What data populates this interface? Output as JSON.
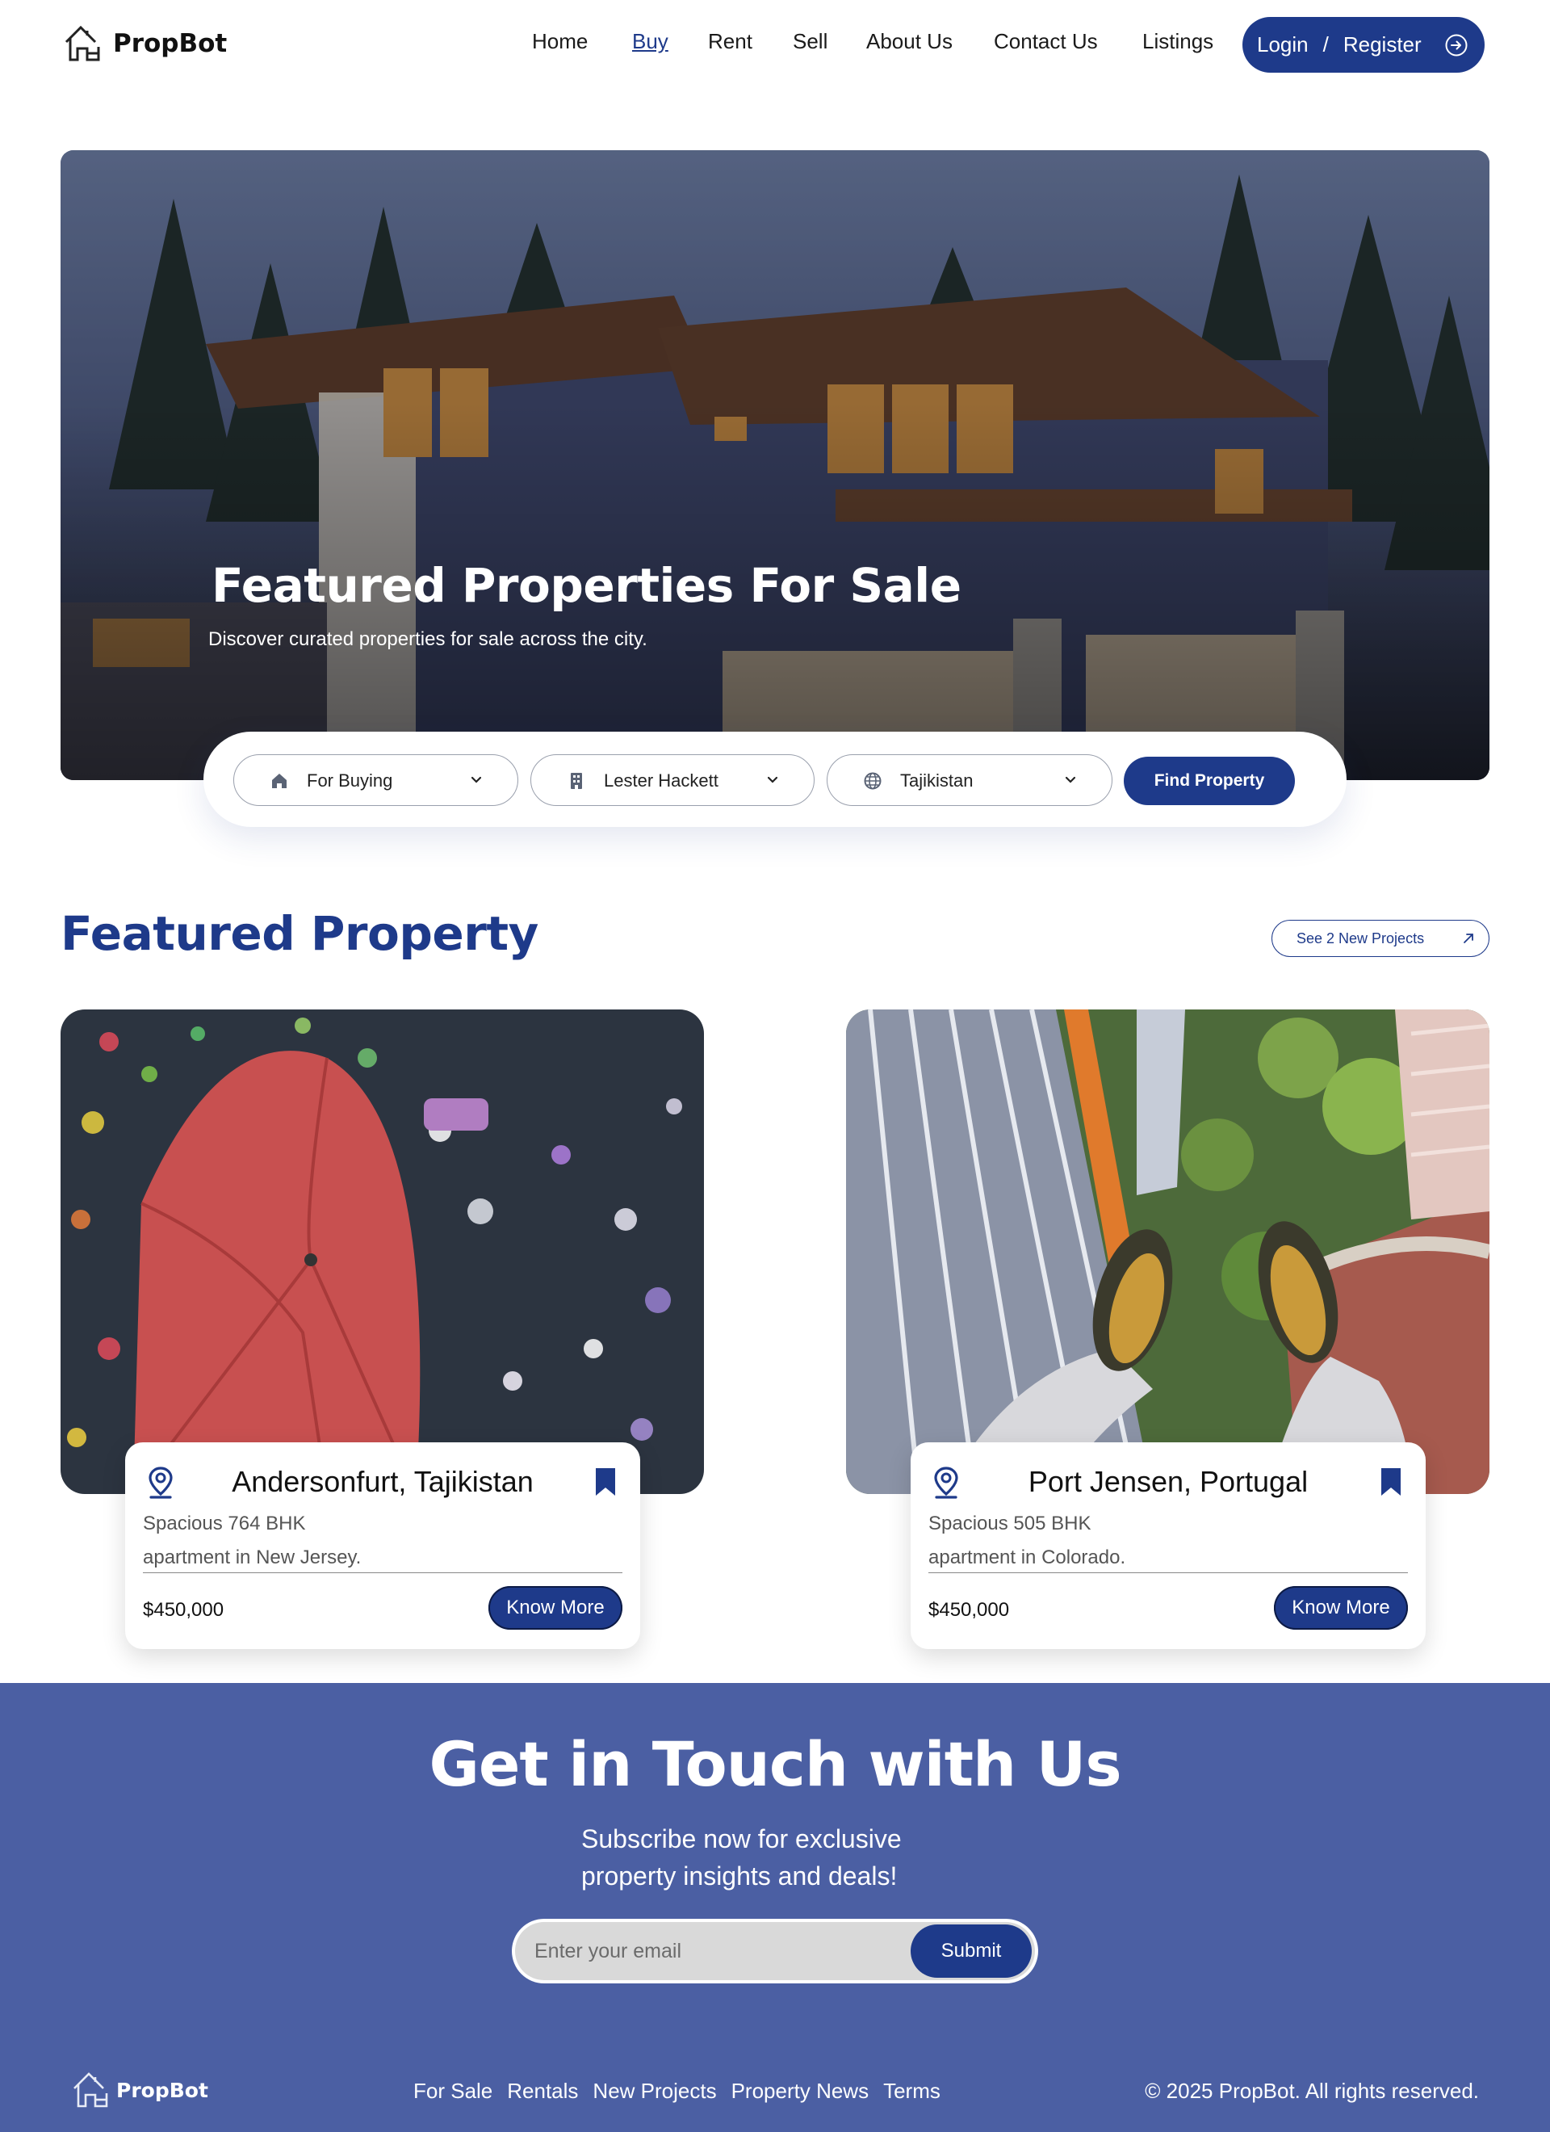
{
  "brand": {
    "name": "PropBot",
    "accent": "#1e3a8a",
    "footer_bg": "#4b5fa3"
  },
  "nav": {
    "links": [
      {
        "label": "Home",
        "active": false
      },
      {
        "label": "Buy",
        "active": true
      },
      {
        "label": "Rent",
        "active": false
      },
      {
        "label": "Sell",
        "active": false
      },
      {
        "label": "About Us",
        "active": false
      },
      {
        "label": "Contact Us",
        "active": false
      },
      {
        "label": "Listings",
        "active": false
      }
    ],
    "login_label": "Login",
    "separator": "/",
    "register_label": "Register",
    "auth_icon": "arrow-circle-right-icon"
  },
  "hero": {
    "title": "Featured Properties For Sale",
    "subtitle": "Discover curated properties for sale across the city."
  },
  "search": {
    "purpose": {
      "icon": "home-icon",
      "value": "For Buying"
    },
    "agent": {
      "icon": "building-icon",
      "value": "Lester Hackett"
    },
    "country": {
      "icon": "globe-icon",
      "value": "Tajikistan"
    },
    "find_label": "Find Property"
  },
  "featured": {
    "title": "Featured Property",
    "see_label": "See 2 New Projects",
    "cards": [
      {
        "location": "Andersonfurt, Tajikistan",
        "desc_line1": "Spacious 764 BHK",
        "desc_line2": "apartment in New Jersey.",
        "price": "$450,000",
        "cta": "Know More"
      },
      {
        "location": "Port Jensen, Portugal",
        "desc_line1": "Spacious 505 BHK",
        "desc_line2": "apartment in Colorado.",
        "price": "$450,000",
        "cta": "Know More"
      }
    ]
  },
  "contact": {
    "title": "Get in Touch with Us",
    "subtitle": "Subscribe now for exclusive property insights and deals!",
    "email_placeholder": "Enter your email",
    "submit_label": "Submit"
  },
  "footer": {
    "brand": "PropBot",
    "links": [
      "For Sale",
      "Rentals",
      "New Projects",
      "Property News",
      "Terms"
    ],
    "copyright": "© 2025 PropBot. All rights reserved."
  }
}
